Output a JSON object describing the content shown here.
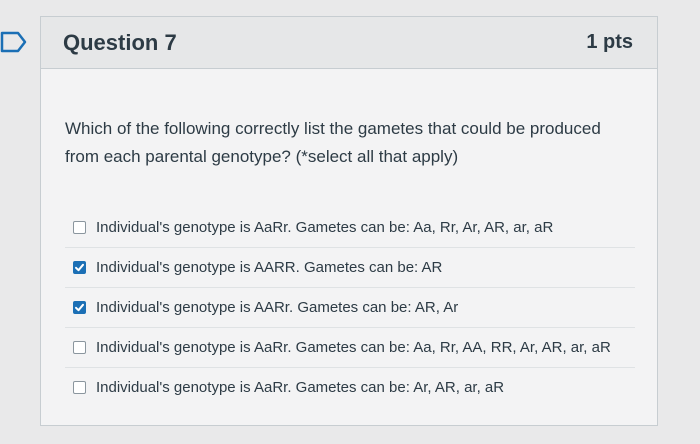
{
  "question": {
    "title": "Question 7",
    "points": "1 pts",
    "text": "Which of the following correctly list the gametes that could be produced from each parental genotype? (*select all that apply)"
  },
  "answers": [
    {
      "label": "Individual's genotype is AaRr. Gametes can be: Aa, Rr, Ar, AR, ar, aR",
      "checked": false
    },
    {
      "label": "Individual's genotype is AARR. Gametes can be: AR",
      "checked": true
    },
    {
      "label": "Individual's genotype is AARr. Gametes can be: AR, Ar",
      "checked": true
    },
    {
      "label": "Individual's genotype is AaRr. Gametes can be: Aa, Rr, AA, RR, Ar, AR, ar, aR",
      "checked": false
    },
    {
      "label": "Individual's genotype is AaRr. Gametes can be: Ar, AR, ar, aR",
      "checked": false
    }
  ],
  "colors": {
    "checkbox_checked": "#1b6fb5",
    "text": "#2d3b45",
    "bookmark_outline": "#1b6fb5"
  },
  "icons": {
    "bookmark": "bookmark-flag-icon",
    "check": "checkmark-icon"
  }
}
